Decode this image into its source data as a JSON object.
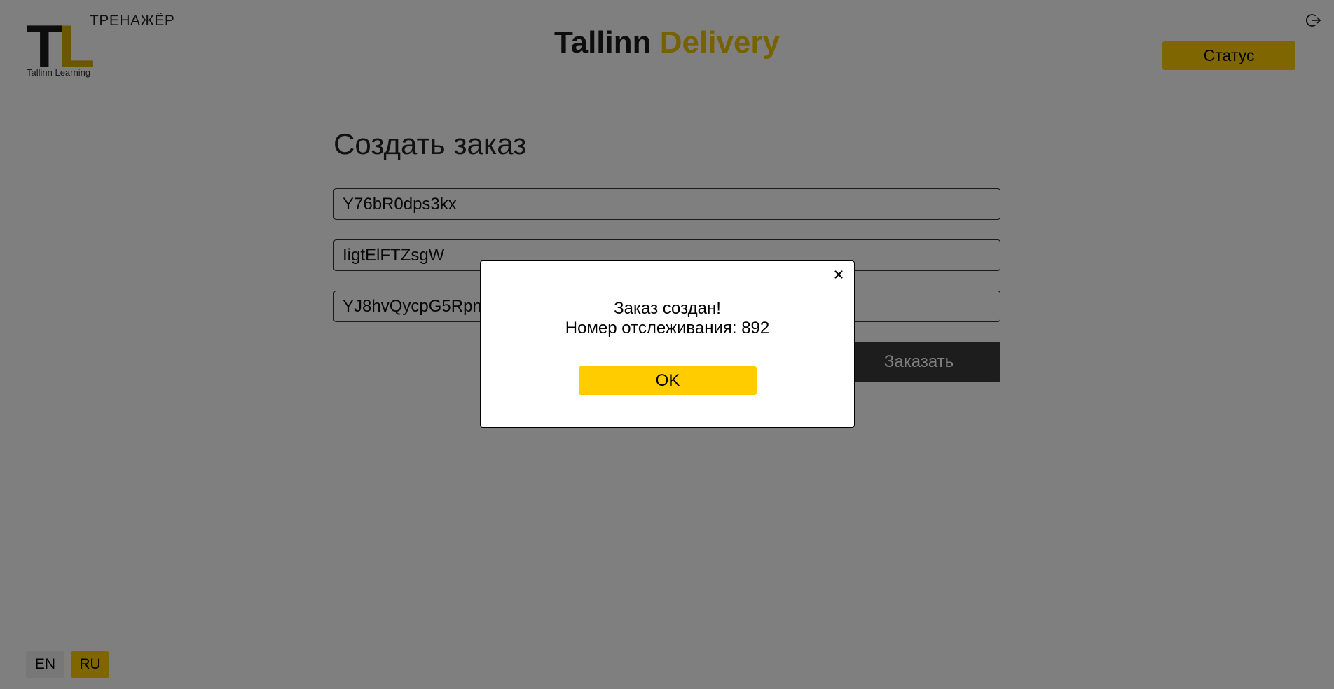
{
  "header": {
    "logo_letter_1": "T",
    "logo_letter_2": "L",
    "logo_subtitle": "Tallinn Learning",
    "trainer_label": "ТРЕНАЖЁР",
    "brand_part_1": "Tallinn",
    "brand_part_2": "Delivery",
    "status_button": "Статус",
    "logout_icon": "logout-icon"
  },
  "form": {
    "title": "Создать заказ",
    "field_1_value": "Y76bR0dps3kx",
    "field_2_value": "IigtElFTZsgW",
    "field_3_value": "YJ8hvQycpG5Rpn",
    "submit_button": "Заказать"
  },
  "language": {
    "en": "EN",
    "ru": "RU",
    "active": "RU"
  },
  "modal": {
    "line_1": "Заказ создан!",
    "line_2": "Номер отслеживания: 892",
    "ok_button": "OK",
    "close_icon": "close-icon"
  },
  "colors": {
    "accent": "#ffcc00",
    "dark": "#3a3a3a",
    "overlay": "rgba(0,0,0,0.5)"
  }
}
